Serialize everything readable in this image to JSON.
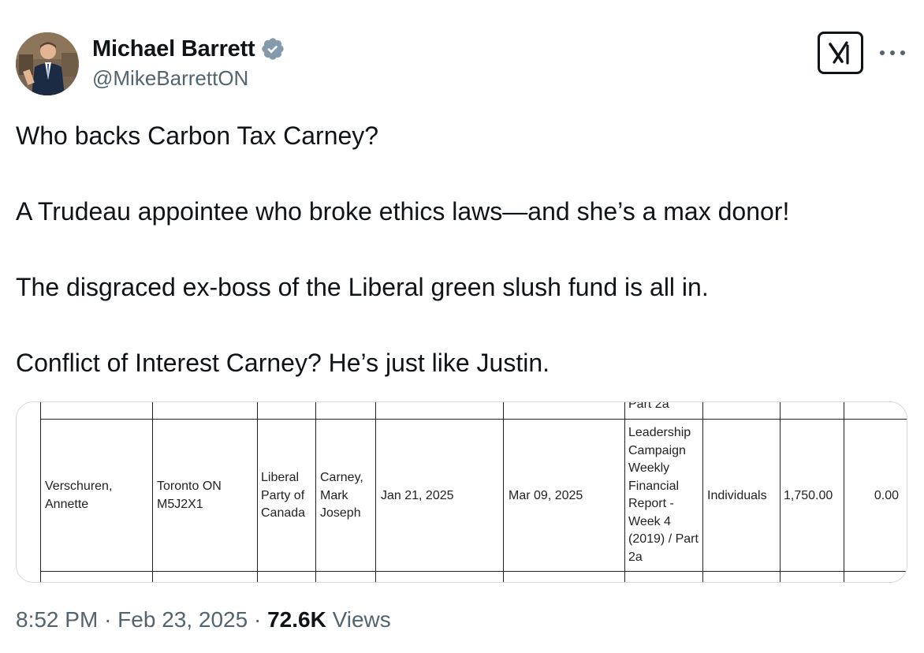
{
  "author": {
    "name": "Michael Barrett",
    "handle": "@MikeBarrettON",
    "verified_icon": "verified-badge-icon"
  },
  "tweet": {
    "paragraphs": [
      "Who backs Carbon Tax Carney?",
      "A Trudeau appointee who broke ethics laws—and she’s a max donor!",
      "The disgraced ex-boss of the Liberal green slush fund is all in.",
      "Conflict of Interest Carney? He’s just like Justin."
    ]
  },
  "media": {
    "top_partial": "Part 2a",
    "row": {
      "contributor": "Verschuren, Annette",
      "location": "Toronto ON M5J2X1",
      "party": "Liberal Party of Canada",
      "candidate": "Carney, Mark Joseph",
      "received_date": "Jan 21, 2025",
      "report_date": "Mar 09, 2025",
      "report": "Leadership Campaign Weekly Financial Report - Week 4 (2019) / Part 2a",
      "contributor_type": "Individuals",
      "monetary": "1,750.00",
      "non_monetary": "0.00"
    }
  },
  "meta": {
    "time": "8:52 PM",
    "separator": "·",
    "date": "Feb 23, 2025",
    "views_count": "72.6K",
    "views_label": "Views"
  },
  "icons": {
    "grok": "grok-icon",
    "more": "more-icon"
  }
}
